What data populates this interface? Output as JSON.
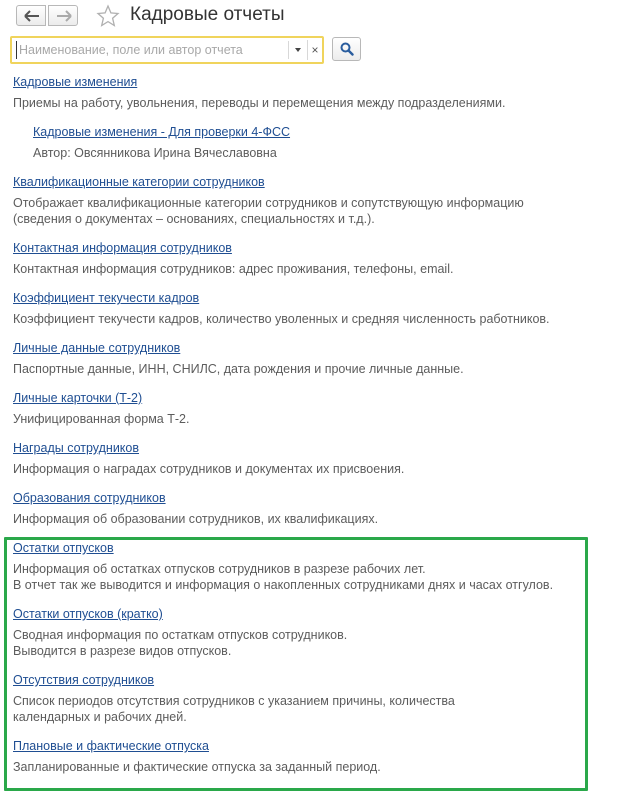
{
  "header": {
    "title": "Кадровые отчеты",
    "back_icon": "arrow-left-icon",
    "forward_icon": "arrow-right-icon",
    "favorite_icon": "star-icon"
  },
  "search": {
    "placeholder": "Наименование, поле или автор отчета",
    "value": "",
    "clear_label": "×",
    "search_icon": "magnifier-icon"
  },
  "reports": [
    {
      "title": "Кадровые изменения",
      "description": [
        "Приемы на работу, увольнения, переводы и перемещения между подразделениями."
      ]
    },
    {
      "title": "Кадровые изменения - Для проверки 4-ФСС",
      "description": [
        "Автор: Овсянникова Ирина Вячеславовна"
      ]
    },
    {
      "title": "Квалификационные категории сотрудников",
      "description": [
        "Отображает квалификационные категории сотрудников и сопутствующую информацию",
        "(сведения о документах – основаниях, специальностях и т.д.)."
      ]
    },
    {
      "title": "Контактная информация сотрудников",
      "description": [
        "Контактная информация сотрудников: адрес проживания, телефоны, email."
      ]
    },
    {
      "title": "Коэффициент текучести кадров",
      "description": [
        "Коэффициент текучести кадров, количество уволенных и средняя численность работников."
      ]
    },
    {
      "title": "Личные данные сотрудников",
      "description": [
        "Паспортные данные, ИНН, СНИЛС, дата рождения и прочие личные данные."
      ]
    },
    {
      "title": "Личные карточки (Т-2)",
      "description": [
        "Унифицированная форма Т-2."
      ]
    },
    {
      "title": "Награды сотрудников",
      "description": [
        "Информация о наградах сотрудников и документах их присвоения."
      ]
    },
    {
      "title": "Образования сотрудников",
      "description": [
        "Информация об образовании сотрудников, их квалификациях."
      ]
    },
    {
      "title": "Остатки отпусков",
      "description": [
        "Информация об остатках отпусков сотрудников в разрезе рабочих лет.",
        "В отчет так же выводится и информация о накопленных сотрудниками днях и часах отгулов."
      ]
    },
    {
      "title": "Остатки отпусков (кратко)",
      "description": [
        "Сводная информация по остаткам отпусков сотрудников.",
        "Выводится в разрезе видов отпусков."
      ]
    },
    {
      "title": "Отсутствия сотрудников",
      "description": [
        "Список периодов отсутствия сотрудников с указанием причины, количества",
        "календарных и рабочих дней."
      ]
    },
    {
      "title": "Плановые и фактические отпуска",
      "description": [
        "Запланированные и фактические отпуска за заданный период."
      ]
    }
  ],
  "colors": {
    "link": "#1f4e92",
    "description": "#5c5c5c",
    "highlight_border": "#2aa84a",
    "search_border": "#f0d45c"
  }
}
